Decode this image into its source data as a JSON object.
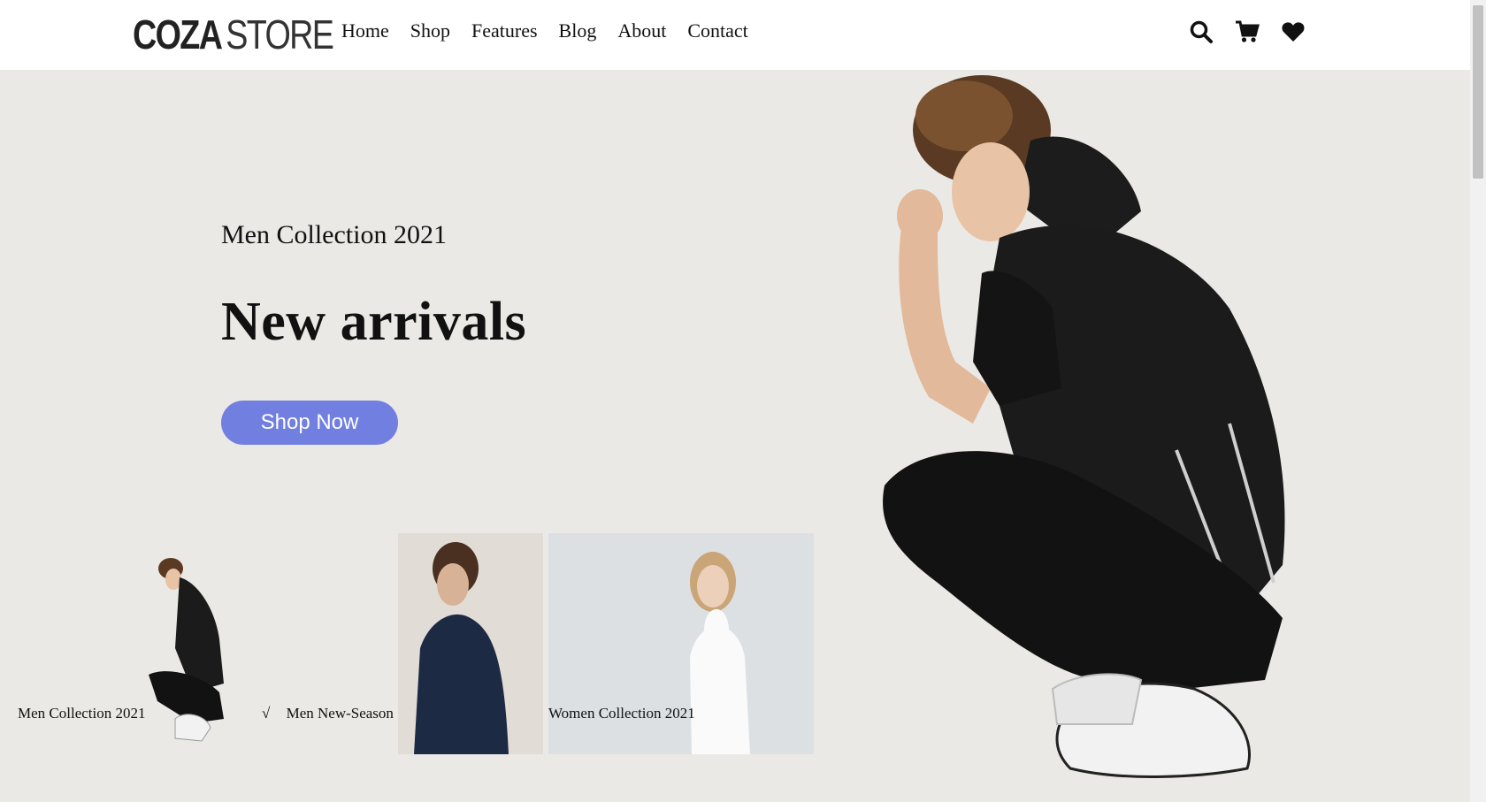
{
  "brand": {
    "bold": "COZA",
    "light": "STORE"
  },
  "nav": {
    "items": [
      "Home",
      "Shop",
      "Features",
      "Blog",
      "About",
      "Contact"
    ]
  },
  "header_icons": [
    "search-icon",
    "cart-icon",
    "heart-icon"
  ],
  "hero": {
    "subtitle": "Men Collection 2021",
    "title": "New arrivals",
    "button_label": "Shop Now"
  },
  "thumbnails": [
    {
      "caption": "Men Collection 2021",
      "prefix": ""
    },
    {
      "caption": "Men New-Season",
      "prefix": "√"
    },
    {
      "caption": "Women Collection 2021",
      "prefix": ""
    }
  ],
  "colors": {
    "accent": "#717fe0",
    "hero_bg": "#ebe9e6"
  }
}
